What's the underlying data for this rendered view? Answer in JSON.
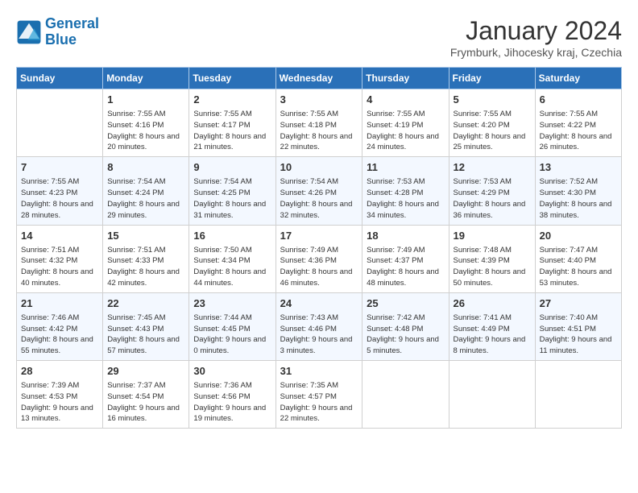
{
  "header": {
    "logo": {
      "line1": "General",
      "line2": "Blue"
    },
    "title": "January 2024",
    "subtitle": "Frymburk, Jihocesky kraj, Czechia"
  },
  "days_of_week": [
    "Sunday",
    "Monday",
    "Tuesday",
    "Wednesday",
    "Thursday",
    "Friday",
    "Saturday"
  ],
  "weeks": [
    [
      {
        "day": "",
        "sunrise": "",
        "sunset": "",
        "daylight": ""
      },
      {
        "day": "1",
        "sunrise": "Sunrise: 7:55 AM",
        "sunset": "Sunset: 4:16 PM",
        "daylight": "Daylight: 8 hours and 20 minutes."
      },
      {
        "day": "2",
        "sunrise": "Sunrise: 7:55 AM",
        "sunset": "Sunset: 4:17 PM",
        "daylight": "Daylight: 8 hours and 21 minutes."
      },
      {
        "day": "3",
        "sunrise": "Sunrise: 7:55 AM",
        "sunset": "Sunset: 4:18 PM",
        "daylight": "Daylight: 8 hours and 22 minutes."
      },
      {
        "day": "4",
        "sunrise": "Sunrise: 7:55 AM",
        "sunset": "Sunset: 4:19 PM",
        "daylight": "Daylight: 8 hours and 24 minutes."
      },
      {
        "day": "5",
        "sunrise": "Sunrise: 7:55 AM",
        "sunset": "Sunset: 4:20 PM",
        "daylight": "Daylight: 8 hours and 25 minutes."
      },
      {
        "day": "6",
        "sunrise": "Sunrise: 7:55 AM",
        "sunset": "Sunset: 4:22 PM",
        "daylight": "Daylight: 8 hours and 26 minutes."
      }
    ],
    [
      {
        "day": "7",
        "sunrise": "Sunrise: 7:55 AM",
        "sunset": "Sunset: 4:23 PM",
        "daylight": "Daylight: 8 hours and 28 minutes."
      },
      {
        "day": "8",
        "sunrise": "Sunrise: 7:54 AM",
        "sunset": "Sunset: 4:24 PM",
        "daylight": "Daylight: 8 hours and 29 minutes."
      },
      {
        "day": "9",
        "sunrise": "Sunrise: 7:54 AM",
        "sunset": "Sunset: 4:25 PM",
        "daylight": "Daylight: 8 hours and 31 minutes."
      },
      {
        "day": "10",
        "sunrise": "Sunrise: 7:54 AM",
        "sunset": "Sunset: 4:26 PM",
        "daylight": "Daylight: 8 hours and 32 minutes."
      },
      {
        "day": "11",
        "sunrise": "Sunrise: 7:53 AM",
        "sunset": "Sunset: 4:28 PM",
        "daylight": "Daylight: 8 hours and 34 minutes."
      },
      {
        "day": "12",
        "sunrise": "Sunrise: 7:53 AM",
        "sunset": "Sunset: 4:29 PM",
        "daylight": "Daylight: 8 hours and 36 minutes."
      },
      {
        "day": "13",
        "sunrise": "Sunrise: 7:52 AM",
        "sunset": "Sunset: 4:30 PM",
        "daylight": "Daylight: 8 hours and 38 minutes."
      }
    ],
    [
      {
        "day": "14",
        "sunrise": "Sunrise: 7:51 AM",
        "sunset": "Sunset: 4:32 PM",
        "daylight": "Daylight: 8 hours and 40 minutes."
      },
      {
        "day": "15",
        "sunrise": "Sunrise: 7:51 AM",
        "sunset": "Sunset: 4:33 PM",
        "daylight": "Daylight: 8 hours and 42 minutes."
      },
      {
        "day": "16",
        "sunrise": "Sunrise: 7:50 AM",
        "sunset": "Sunset: 4:34 PM",
        "daylight": "Daylight: 8 hours and 44 minutes."
      },
      {
        "day": "17",
        "sunrise": "Sunrise: 7:49 AM",
        "sunset": "Sunset: 4:36 PM",
        "daylight": "Daylight: 8 hours and 46 minutes."
      },
      {
        "day": "18",
        "sunrise": "Sunrise: 7:49 AM",
        "sunset": "Sunset: 4:37 PM",
        "daylight": "Daylight: 8 hours and 48 minutes."
      },
      {
        "day": "19",
        "sunrise": "Sunrise: 7:48 AM",
        "sunset": "Sunset: 4:39 PM",
        "daylight": "Daylight: 8 hours and 50 minutes."
      },
      {
        "day": "20",
        "sunrise": "Sunrise: 7:47 AM",
        "sunset": "Sunset: 4:40 PM",
        "daylight": "Daylight: 8 hours and 53 minutes."
      }
    ],
    [
      {
        "day": "21",
        "sunrise": "Sunrise: 7:46 AM",
        "sunset": "Sunset: 4:42 PM",
        "daylight": "Daylight: 8 hours and 55 minutes."
      },
      {
        "day": "22",
        "sunrise": "Sunrise: 7:45 AM",
        "sunset": "Sunset: 4:43 PM",
        "daylight": "Daylight: 8 hours and 57 minutes."
      },
      {
        "day": "23",
        "sunrise": "Sunrise: 7:44 AM",
        "sunset": "Sunset: 4:45 PM",
        "daylight": "Daylight: 9 hours and 0 minutes."
      },
      {
        "day": "24",
        "sunrise": "Sunrise: 7:43 AM",
        "sunset": "Sunset: 4:46 PM",
        "daylight": "Daylight: 9 hours and 3 minutes."
      },
      {
        "day": "25",
        "sunrise": "Sunrise: 7:42 AM",
        "sunset": "Sunset: 4:48 PM",
        "daylight": "Daylight: 9 hours and 5 minutes."
      },
      {
        "day": "26",
        "sunrise": "Sunrise: 7:41 AM",
        "sunset": "Sunset: 4:49 PM",
        "daylight": "Daylight: 9 hours and 8 minutes."
      },
      {
        "day": "27",
        "sunrise": "Sunrise: 7:40 AM",
        "sunset": "Sunset: 4:51 PM",
        "daylight": "Daylight: 9 hours and 11 minutes."
      }
    ],
    [
      {
        "day": "28",
        "sunrise": "Sunrise: 7:39 AM",
        "sunset": "Sunset: 4:53 PM",
        "daylight": "Daylight: 9 hours and 13 minutes."
      },
      {
        "day": "29",
        "sunrise": "Sunrise: 7:37 AM",
        "sunset": "Sunset: 4:54 PM",
        "daylight": "Daylight: 9 hours and 16 minutes."
      },
      {
        "day": "30",
        "sunrise": "Sunrise: 7:36 AM",
        "sunset": "Sunset: 4:56 PM",
        "daylight": "Daylight: 9 hours and 19 minutes."
      },
      {
        "day": "31",
        "sunrise": "Sunrise: 7:35 AM",
        "sunset": "Sunset: 4:57 PM",
        "daylight": "Daylight: 9 hours and 22 minutes."
      },
      {
        "day": "",
        "sunrise": "",
        "sunset": "",
        "daylight": ""
      },
      {
        "day": "",
        "sunrise": "",
        "sunset": "",
        "daylight": ""
      },
      {
        "day": "",
        "sunrise": "",
        "sunset": "",
        "daylight": ""
      }
    ]
  ]
}
